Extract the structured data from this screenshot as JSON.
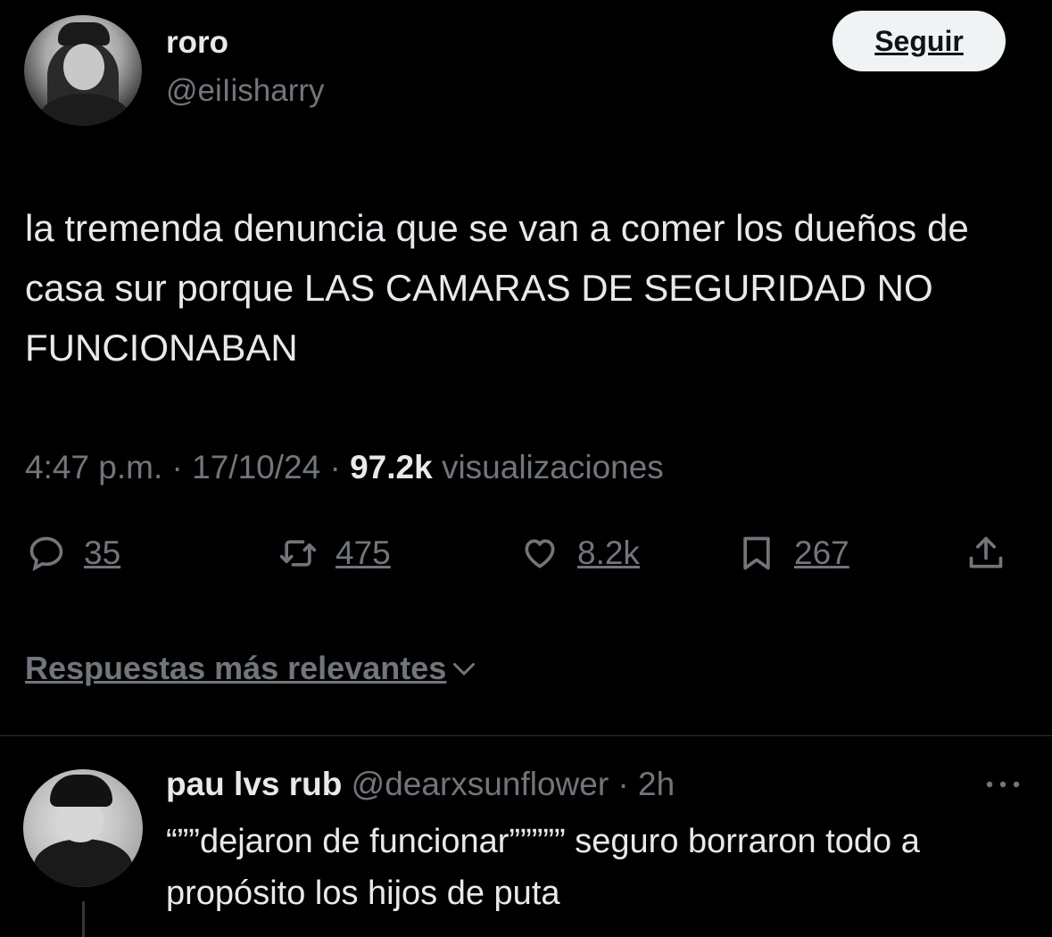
{
  "author": {
    "display_name": "roro",
    "handle": "@eiIisharry",
    "follow_label": "Seguir"
  },
  "tweet": {
    "text": "la tremenda denuncia que se van a comer los dueños de casa sur porque LAS CAMARAS DE SEGURIDAD NO FUNCIONABAN",
    "time": "4:47 p.m.",
    "date": "17/10/24",
    "views_count": "97.2k",
    "views_label": "visualizaciones"
  },
  "actions": {
    "replies": "35",
    "retweets": "475",
    "likes": "8.2k",
    "bookmarks": "267"
  },
  "replies_sort": {
    "label": "Respuestas más relevantes"
  },
  "reply": {
    "display_name": "pau lvs rub",
    "handle": "@dearxsunflower",
    "time": "2h",
    "text": "“””dejaron de funcionar””””” seguro borraron todo a propósito los hijos de puta"
  },
  "icons": {
    "reply": "speech-bubble-icon",
    "retweet": "retweet-icon",
    "like": "heart-icon",
    "bookmark": "bookmark-icon",
    "share": "share-icon",
    "sort": "chevron-down-icon",
    "more": "more-dots-icon"
  },
  "colors": {
    "background": "#000000",
    "text_primary": "#e7e9ea",
    "text_secondary": "#71767b",
    "follow_button_bg": "#eff3f4",
    "divider": "#2f3336"
  }
}
